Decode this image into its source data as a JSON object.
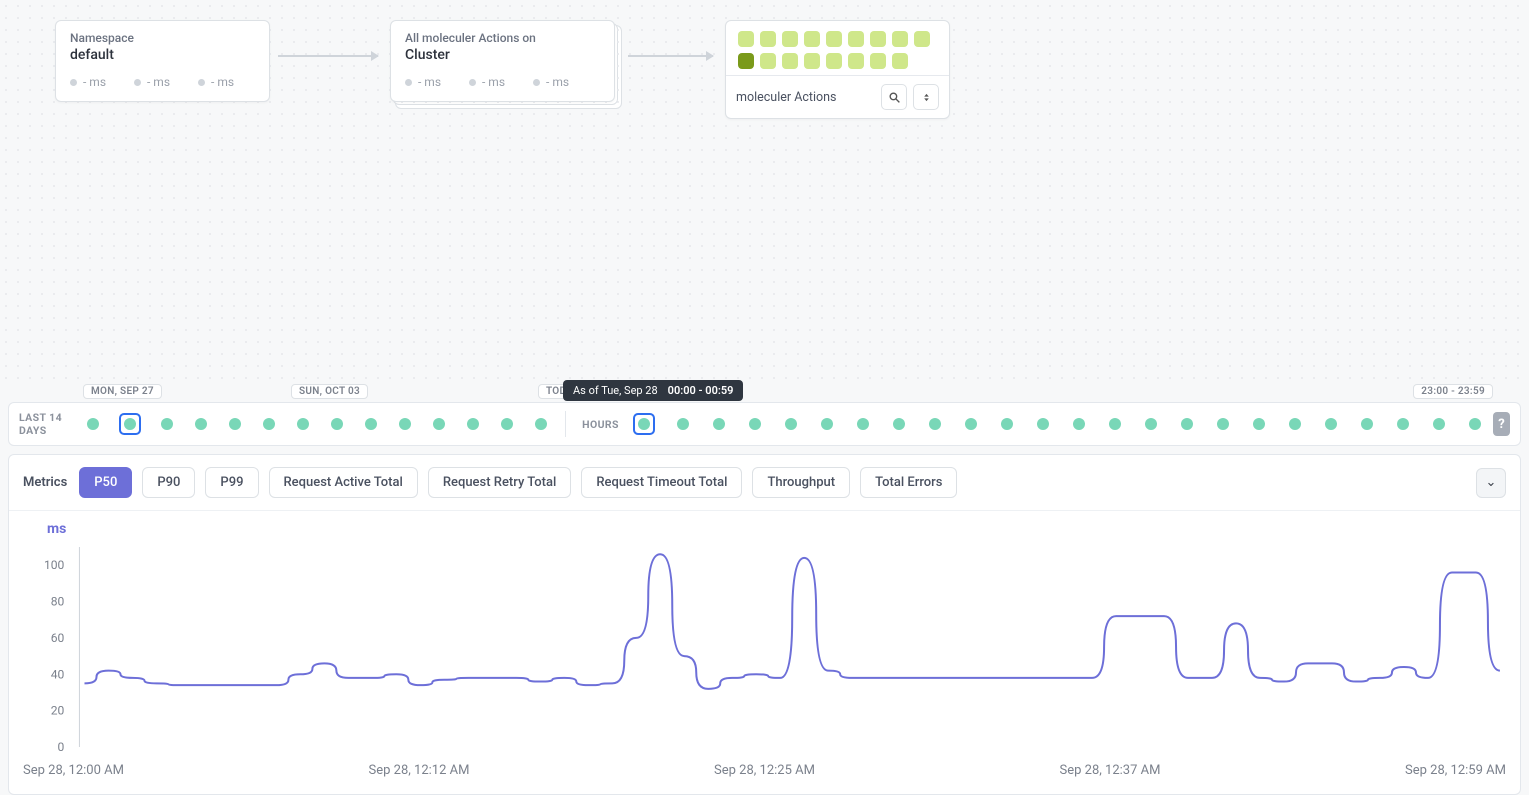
{
  "topology": {
    "namespace_card": {
      "label": "Namespace",
      "value": "default",
      "metrics": [
        "- ms",
        "- ms",
        "- ms"
      ]
    },
    "cluster_card": {
      "label": "All moleculer Actions on",
      "value": "Cluster",
      "metrics": [
        "- ms",
        "- ms",
        "- ms"
      ]
    },
    "actions_card": {
      "footer_label": "moleculer Actions",
      "cells_total": 17,
      "cells_hot_index": 9
    }
  },
  "timeline": {
    "days_label": "LAST 14 DAYS",
    "hours_label": "HOURS",
    "badges": {
      "mon": "MON, SEP 27",
      "sun": "SUN, OCT 03",
      "today": "TODAY",
      "range": "23:00 - 23:59"
    },
    "tooltip": {
      "prefix": "As of Tue, Sep 28",
      "range": "00:00 - 00:59"
    },
    "days_count": 14,
    "days_selected_index": 1,
    "hours_count": 24,
    "hours_selected_index": 0,
    "help": "?"
  },
  "metrics_tabs": {
    "label": "Metrics",
    "items": [
      "P50",
      "P90",
      "P99",
      "Request Active Total",
      "Request Retry Total",
      "Request Timeout Total",
      "Throughput",
      "Total Errors"
    ],
    "active_index": 0,
    "collapse_glyph": "⌄"
  },
  "chart_data": {
    "type": "line",
    "title": "",
    "ylabel": "ms",
    "ylim": [
      0,
      110
    ],
    "yticks": [
      0,
      20,
      40,
      60,
      80,
      100
    ],
    "x_range": [
      "Sep 28, 12:00 AM",
      "Sep 28, 12:59 AM"
    ],
    "x_ticks": [
      "Sep 28, 12:00 AM",
      "Sep 28, 12:12 AM",
      "Sep 28, 12:25 AM",
      "Sep 28, 12:37 AM",
      "Sep 28, 12:59 AM"
    ],
    "series": [
      {
        "name": "P50",
        "x_minutes": [
          0,
          1,
          2,
          3,
          4,
          5,
          6,
          7,
          8,
          9,
          10,
          11,
          12,
          13,
          14,
          15,
          16,
          17,
          18,
          19,
          20,
          21,
          22,
          23,
          24,
          25,
          26,
          27,
          28,
          29,
          30,
          31,
          32,
          33,
          34,
          35,
          36,
          37,
          38,
          39,
          40,
          41,
          42,
          43,
          44,
          45,
          46,
          47,
          48,
          49,
          50,
          51,
          52,
          53,
          54,
          55,
          56,
          57,
          58,
          59
        ],
        "values": [
          35,
          42,
          38,
          35,
          34,
          34,
          34,
          34,
          34,
          40,
          46,
          38,
          38,
          40,
          34,
          37,
          38,
          38,
          38,
          36,
          38,
          34,
          35,
          60,
          106,
          50,
          32,
          38,
          40,
          38,
          104,
          42,
          38,
          38,
          38,
          38,
          38,
          38,
          38,
          38,
          38,
          38,
          38,
          72,
          72,
          72,
          38,
          38,
          68,
          38,
          36,
          46,
          46,
          36,
          38,
          44,
          38,
          96,
          96,
          42
        ]
      }
    ]
  }
}
